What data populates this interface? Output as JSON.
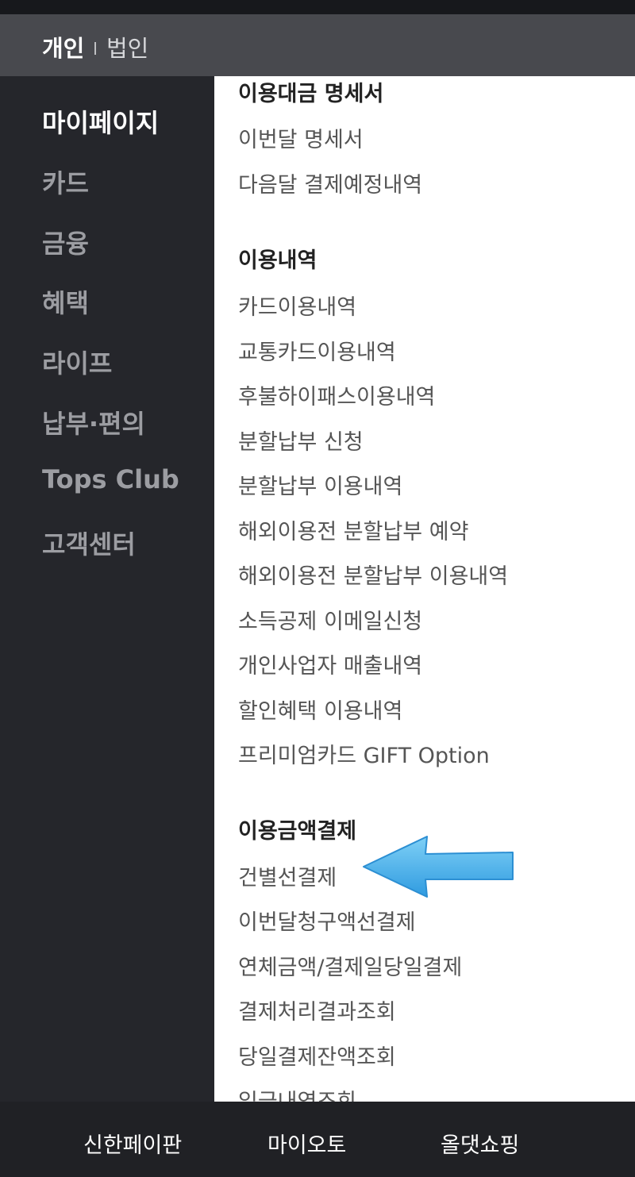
{
  "header": {
    "tabs": [
      {
        "label": "개인",
        "active": true
      },
      {
        "label": "법인",
        "active": false
      }
    ]
  },
  "sidebar": {
    "items": [
      {
        "label": "마이페이지",
        "active": true
      },
      {
        "label": "카드"
      },
      {
        "label": "금융"
      },
      {
        "label": "혜택"
      },
      {
        "label": "라이프"
      },
      {
        "label": "납부·편의"
      },
      {
        "label": "Tops Club"
      },
      {
        "label": "고객센터"
      }
    ]
  },
  "content": {
    "sections": [
      {
        "title": "이용대금 명세서",
        "items": [
          "이번달 명세서",
          "다음달 결제예정내역"
        ]
      },
      {
        "title": "이용내역",
        "items": [
          "카드이용내역",
          "교통카드이용내역",
          "후불하이패스이용내역",
          "분할납부 신청",
          "분할납부 이용내역",
          "해외이용전 분할납부 예약",
          "해외이용전 분할납부 이용내역",
          "소득공제 이메일신청",
          "개인사업자 매출내역",
          "할인혜택 이용내역",
          "프리미엄카드 GIFT Option"
        ]
      },
      {
        "title": "이용금액결제",
        "items": [
          "건별선결제",
          "이번달청구액선결제",
          "연체금액/결제일당일결제",
          "결제처리결과조회",
          "당일결제잔액조회",
          "입금내역조회"
        ]
      }
    ],
    "annotation_arrow_color": "#3aaeea"
  },
  "bottom_nav": {
    "items": [
      "신한페이판",
      "마이오토",
      "올댓쇼핑"
    ]
  }
}
